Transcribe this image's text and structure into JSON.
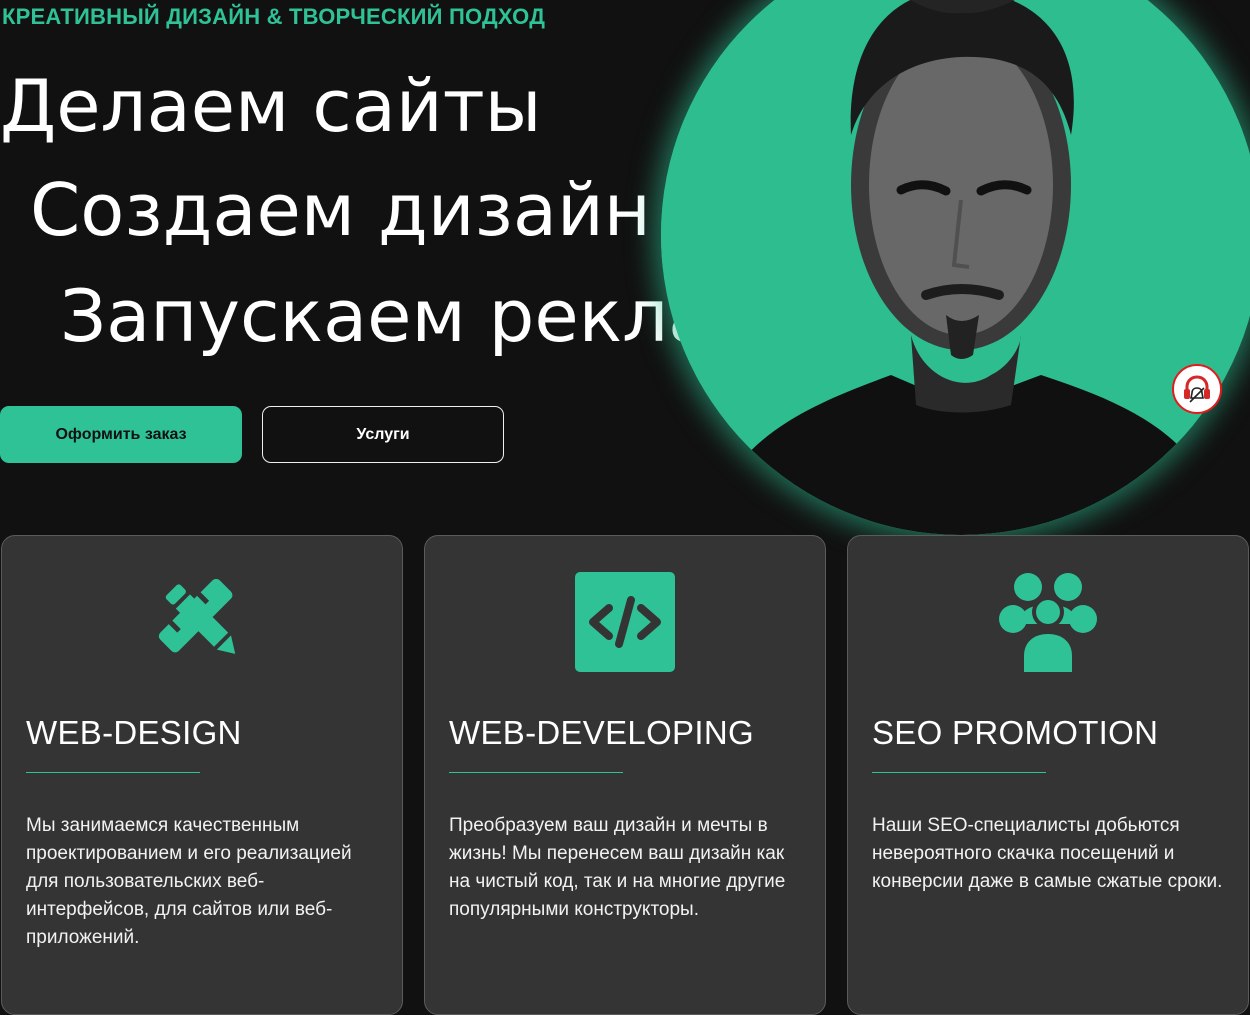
{
  "hero": {
    "eyebrow": "КРЕАТИВНЫЙ ДИЗАЙН & ТВОРЧЕСКИЙ ПОДХОД",
    "lines": [
      "Делаем сайты",
      "Создаем дизайн",
      "Запускаем рекламу"
    ],
    "order_button": "Оформить заказ",
    "services_button": "Услуги"
  },
  "cards": [
    {
      "icon": "pencil-ruler-icon",
      "title": "WEB-DESIGN",
      "text": "Мы занимаемся качественным проектированием и его реализацией для пользовательских веб-интерфейсов, для сайтов или веб-приложений."
    },
    {
      "icon": "code-icon",
      "title": "WEB-DEVELOPING",
      "text": "Преобразуем ваш дизайн и мечты в жизнь! Мы перенесем ваш дизайн как на чистый код, так и на многие другие популярными конструкторы."
    },
    {
      "icon": "users-group-icon",
      "title": "SEO PROMOTION",
      "text": "Наши SEO-специалисты добьются невероятного скачка посещений и конверсии даже в самые сжатые сроки."
    }
  ],
  "support_widget": {
    "icon": "headset-icon"
  },
  "colors": {
    "accent": "#2fc296",
    "background": "#111111",
    "card": "#343434",
    "widget_border": "#e31b1b"
  }
}
